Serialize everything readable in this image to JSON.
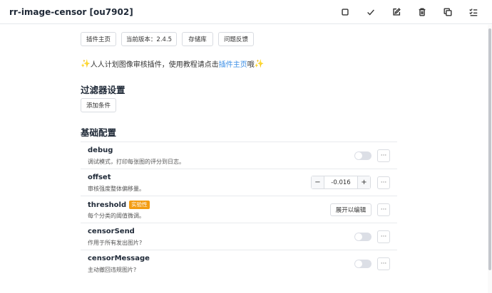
{
  "header": {
    "title": "rr-image-censor [ou7902]"
  },
  "links": {
    "homepage": "插件主页",
    "version": "当前版本：2.4.5",
    "repository": "存储库",
    "feedback": "问题反馈"
  },
  "intro": {
    "star": "✨",
    "text_before": "人人计划图像审核插件，使用教程请点击",
    "link_text": "插件主页",
    "text_after": "哦"
  },
  "filter_section": {
    "heading": "过滤器设置",
    "add_condition": "添加条件"
  },
  "basic_section": {
    "heading": "基础配置",
    "items": [
      {
        "name": "debug",
        "description": "调试模式，打印每张图的评分到日志。",
        "control": "toggle",
        "enabled": false
      },
      {
        "name": "offset",
        "description": "审核强度整体偏移量。",
        "control": "stepper",
        "value": "-0.016"
      },
      {
        "name": "threshold",
        "badge": "实验性",
        "description": "每个分类的阈值微调。",
        "control": "edit",
        "button_label": "展开以编辑"
      },
      {
        "name": "censorSend",
        "description": "作用于所有发出图片?",
        "control": "toggle",
        "enabled": false
      },
      {
        "name": "censorMessage",
        "description": "主动撤回违规图片?",
        "control": "toggle",
        "enabled": false
      }
    ]
  },
  "more_label": "···",
  "stepper": {
    "minus": "−",
    "plus": "+"
  },
  "colors": {
    "accent": "#3a8ee6",
    "badge": "#f39c12",
    "toggle_off": "#dcdfe6"
  },
  "icons": [
    "square-icon",
    "check-icon",
    "edit-icon",
    "trash-icon",
    "copy-icon",
    "checklist-icon"
  ]
}
